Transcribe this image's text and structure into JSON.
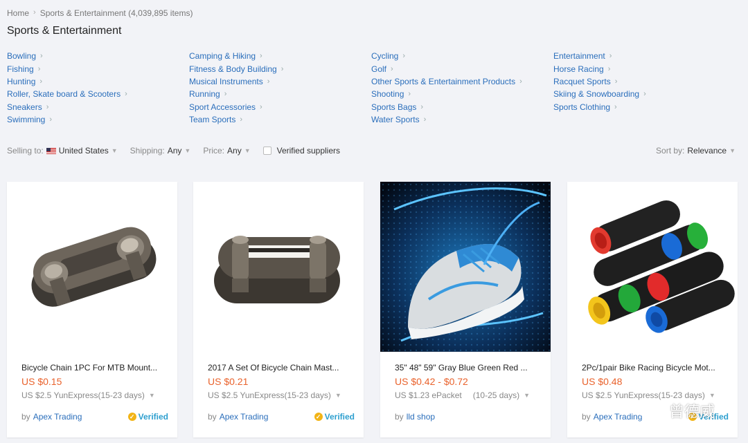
{
  "breadcrumb": {
    "home": "Home",
    "current": "Sports & Entertainment (4,039,895 items)"
  },
  "page_title": "Sports & Entertainment",
  "categories": [
    "Bowling",
    "Fishing",
    "Hunting",
    "Roller, Skate board & Scooters",
    "Sneakers",
    "Swimming",
    "Camping & Hiking",
    "Fitness & Body Building",
    "Musical Instruments",
    "Running",
    "Sport Accessories",
    "Team Sports",
    "Cycling",
    "Golf",
    "Other Sports & Entertainment Products",
    "Shooting",
    "Sports Bags",
    "Water Sports",
    "Entertainment",
    "Horse Racing",
    "Racquet Sports",
    "Skiing & Snowboarding",
    "Sports Clothing"
  ],
  "filters": {
    "selling_to_label": "Selling to:",
    "selling_to_value": "United States",
    "shipping_label": "Shipping:",
    "shipping_value": "Any",
    "price_label": "Price:",
    "price_value": "Any",
    "verified_label": "Verified suppliers",
    "sort_label": "Sort by:",
    "sort_value": "Relevance"
  },
  "products": [
    {
      "title": "Bicycle Chain 1PC For MTB Mount...",
      "price": "US $0.15",
      "shipping": "US $2.5 YunExpress",
      "shipping_days": "(15-23 days)",
      "by": "by",
      "seller": "Apex Trading",
      "verified": "Verified"
    },
    {
      "title": "2017 A Set Of Bicycle Chain Mast...",
      "price": "US $0.21",
      "shipping": "US $2.5 YunExpress",
      "shipping_days": "(15-23 days)",
      "by": "by",
      "seller": "Apex Trading",
      "verified": "Verified"
    },
    {
      "title": "35\" 48\" 59\" Gray Blue Green Red ...",
      "price": "US $0.42 - $0.72",
      "shipping": "US $1.23 ePacket",
      "shipping_days": "(10-25 days)",
      "by": "by",
      "seller": "lld shop",
      "verified": ""
    },
    {
      "title": "2Pc/1pair Bike Racing Bicycle Mot...",
      "price": "US $0.48",
      "shipping": "US $2.5 YunExpress",
      "shipping_days": "(15-23 days)",
      "by": "by",
      "seller": "Apex Trading",
      "verified": "Verified"
    }
  ],
  "watermark": "曾德威",
  "colors": {
    "link": "#2a6ebb",
    "price": "#e9622c",
    "verified": "#2d9fcf",
    "verified_badge": "#f2b417"
  }
}
